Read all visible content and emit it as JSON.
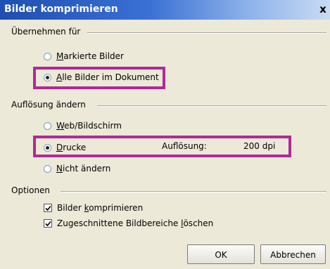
{
  "dialog": {
    "title": "Bilder komprimieren",
    "close_glyph": "x"
  },
  "apply_to": {
    "label": "Übernehmen für",
    "options": [
      {
        "mnemonic": "M",
        "rest": "arkierte Bilder",
        "selected": false
      },
      {
        "mnemonic": "A",
        "rest": "lle Bilder im Dokument",
        "selected": true
      }
    ]
  },
  "resolution": {
    "label": "Auflösung ändern",
    "options": [
      {
        "mnemonic": "W",
        "rest": "eb/Bildschirm",
        "selected": false
      },
      {
        "mnemonic": "D",
        "rest": "rucke",
        "selected": true
      },
      {
        "mnemonic": "N",
        "rest": "icht ändern",
        "selected": false
      }
    ],
    "value_label": "Auflösung:",
    "value": "200 dpi"
  },
  "options": {
    "label": "Optionen",
    "checks": [
      {
        "before": "Bilder ",
        "mnemonic": "k",
        "after": "omprimieren",
        "checked": true
      },
      {
        "before": "Zugeschnittene Bildbereiche ",
        "mnemonic": "l",
        "after": "öschen",
        "checked": true
      }
    ]
  },
  "buttons": {
    "ok": "OK",
    "cancel": "Abbrechen"
  },
  "colors": {
    "highlight": "#b02a93",
    "titlebar": "#1f4fb0"
  }
}
